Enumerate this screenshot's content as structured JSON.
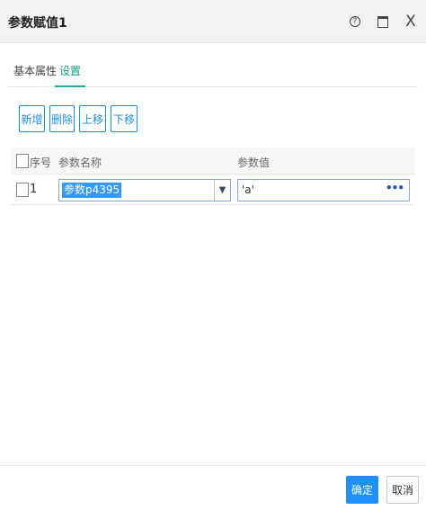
{
  "window": {
    "title": "参数赋值1",
    "help_glyph": "?",
    "close_glyph": "X"
  },
  "tabs": [
    {
      "label": "基本属性"
    },
    {
      "label": "设置"
    }
  ],
  "toolbar": {
    "add": "新增",
    "delete": "删除",
    "move_up": "上移",
    "move_down": "下移"
  },
  "table": {
    "headers": {
      "index": "序号",
      "param_name": "参数名称",
      "param_value": "参数值"
    },
    "rows": [
      {
        "index": "1",
        "param_name": "参数p4395",
        "param_value": "'a'",
        "dropdown_glyph": "▼",
        "more_glyph": "•••"
      }
    ]
  },
  "footer": {
    "ok": "确定",
    "cancel": "取消"
  },
  "colors": {
    "accent": "#1e90ff",
    "tab_active": "#16a085",
    "selection": "#3399ff"
  }
}
